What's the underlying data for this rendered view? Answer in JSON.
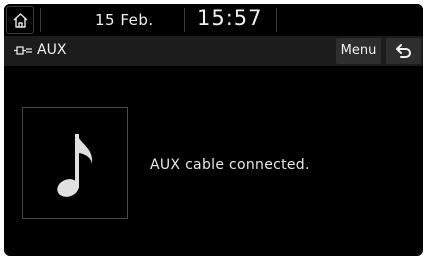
{
  "status": {
    "date": "15 Feb.",
    "time": "15:57",
    "home_icon": "home-icon"
  },
  "titlebar": {
    "source_icon": "aux-plug-icon",
    "source_label": "AUX",
    "menu_label": "Menu",
    "back_icon": "back-arrow-icon"
  },
  "content": {
    "art_icon": "music-note-icon",
    "message": "AUX cable connected."
  }
}
